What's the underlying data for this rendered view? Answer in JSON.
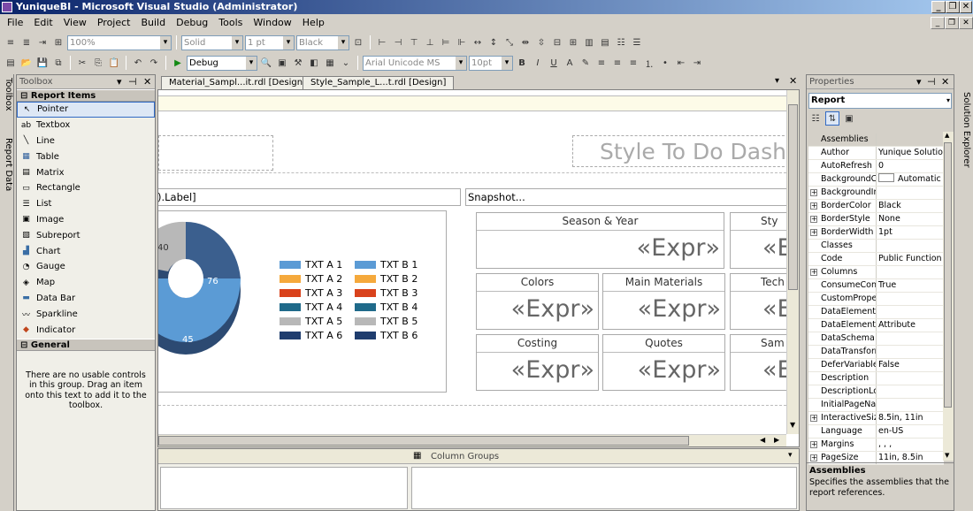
{
  "window": {
    "title": "YuniqueBI - Microsoft Visual Studio (Administrator)"
  },
  "menu": [
    "File",
    "Edit",
    "View",
    "Project",
    "Build",
    "Debug",
    "Tools",
    "Window",
    "Help"
  ],
  "toolbar1": {
    "zoom": "100%",
    "border_style": "Solid",
    "border_width": "1 pt",
    "border_color": "Black"
  },
  "toolbar2": {
    "config": "Debug",
    "font": "Arial Unicode MS",
    "font_size": "10pt"
  },
  "toolbox": {
    "title": "Toolbox",
    "group1": "Report Items",
    "items": [
      {
        "label": "Pointer",
        "icon": "pointer-icon",
        "glyph": "↖"
      },
      {
        "label": "Textbox",
        "icon": "textbox-icon",
        "glyph": "ab"
      },
      {
        "label": "Line",
        "icon": "line-icon",
        "glyph": "╲"
      },
      {
        "label": "Table",
        "icon": "table-icon",
        "glyph": "▦"
      },
      {
        "label": "Matrix",
        "icon": "matrix-icon",
        "glyph": "▤"
      },
      {
        "label": "Rectangle",
        "icon": "rectangle-icon",
        "glyph": "▭"
      },
      {
        "label": "List",
        "icon": "list-icon",
        "glyph": "☰"
      },
      {
        "label": "Image",
        "icon": "image-icon",
        "glyph": "▣"
      },
      {
        "label": "Subreport",
        "icon": "subreport-icon",
        "glyph": "▧"
      },
      {
        "label": "Chart",
        "icon": "chart-icon",
        "glyph": "▟"
      },
      {
        "label": "Gauge",
        "icon": "gauge-icon",
        "glyph": "◔"
      },
      {
        "label": "Map",
        "icon": "map-icon",
        "glyph": "◈"
      },
      {
        "label": "Data Bar",
        "icon": "databar-icon",
        "glyph": "▬"
      },
      {
        "label": "Sparkline",
        "icon": "sparkline-icon",
        "glyph": "〰"
      },
      {
        "label": "Indicator",
        "icon": "indicator-icon",
        "glyph": "◆"
      }
    ],
    "group2": "General",
    "empty_text": "There are no usable controls in this group. Drag an item onto this text to add it to the toolbox."
  },
  "rail": {
    "toolbox_tab": "Toolbox",
    "report_data_tab": "Report Data",
    "solution_tab": "Solution Explorer"
  },
  "tabs": [
    "Material_Sampl...it.rdl [Design]",
    "Style_Sample_L...t.rdl [Design]"
  ],
  "report": {
    "title_text": "Style To Do Dash",
    "left_header": ").Label]",
    "snapshot_header": "Snapshot...",
    "donut_labels": [
      "40",
      "76",
      "45"
    ],
    "legend_a": [
      "TXT A 1",
      "TXT A 2",
      "TXT A 3",
      "TXT A 4",
      "TXT A 5",
      "TXT A 6"
    ],
    "legend_b": [
      "TXT B 1",
      "TXT B 2",
      "TXT B 3",
      "TXT B 4",
      "TXT B 5",
      "TXT B 6"
    ],
    "legend_colors": [
      "#5b9bd5",
      "#f5a93c",
      "#d9421c",
      "#1f6a8a",
      "#b8b8b8",
      "#1f3d6e"
    ],
    "cells": [
      {
        "header": "Season & Year",
        "value": "«Expr»"
      },
      {
        "header": "Sty",
        "value": "«E"
      },
      {
        "header": "Colors",
        "value": "«Expr»"
      },
      {
        "header": "Main Materials",
        "value": "«Expr»"
      },
      {
        "header": "Tech",
        "value": "«E"
      },
      {
        "header": "Costing",
        "value": "«Expr»"
      },
      {
        "header": "Quotes",
        "value": "«Expr»"
      },
      {
        "header": "Sam",
        "value": "«E"
      }
    ]
  },
  "groups": {
    "column_groups": "Column Groups"
  },
  "properties": {
    "title": "Properties",
    "object": "Report",
    "rows": [
      {
        "name": "Assemblies",
        "value": "",
        "expand": false,
        "sel": true
      },
      {
        "name": "Author",
        "value": "Yunique Solution",
        "expand": false
      },
      {
        "name": "AutoRefresh",
        "value": "0",
        "expand": false
      },
      {
        "name": "BackgroundCol",
        "value": "Automatic",
        "expand": false
      },
      {
        "name": "BackgroundIma",
        "value": "",
        "expand": true
      },
      {
        "name": "BorderColor",
        "value": "Black",
        "expand": true
      },
      {
        "name": "BorderStyle",
        "value": "None",
        "expand": true
      },
      {
        "name": "BorderWidth",
        "value": "1pt",
        "expand": true
      },
      {
        "name": "Classes",
        "value": "",
        "expand": false
      },
      {
        "name": "Code",
        "value": "Public Function F",
        "expand": false
      },
      {
        "name": "Columns",
        "value": "",
        "expand": true
      },
      {
        "name": "ConsumeConta",
        "value": "True",
        "expand": false
      },
      {
        "name": "CustomPropert",
        "value": "",
        "expand": false
      },
      {
        "name": "DataElementNa",
        "value": "",
        "expand": false
      },
      {
        "name": "DataElementSt",
        "value": "Attribute",
        "expand": false
      },
      {
        "name": "DataSchema",
        "value": "",
        "expand": false
      },
      {
        "name": "DataTransform",
        "value": "",
        "expand": false
      },
      {
        "name": "DeferVariableE",
        "value": "False",
        "expand": false
      },
      {
        "name": "Description",
        "value": "",
        "expand": false
      },
      {
        "name": "DescriptionLocl",
        "value": "",
        "expand": false
      },
      {
        "name": "InitialPageNam",
        "value": "",
        "expand": false
      },
      {
        "name": "InteractiveSize",
        "value": "8.5in, 11in",
        "expand": true
      },
      {
        "name": "Language",
        "value": "en-US",
        "expand": false
      },
      {
        "name": "Margins",
        "value": ", , ,",
        "expand": true
      },
      {
        "name": "PageSize",
        "value": "11in, 8.5in",
        "expand": true
      }
    ],
    "desc_title": "Assemblies",
    "desc_text": "Specifies the assemblies that the report references."
  }
}
